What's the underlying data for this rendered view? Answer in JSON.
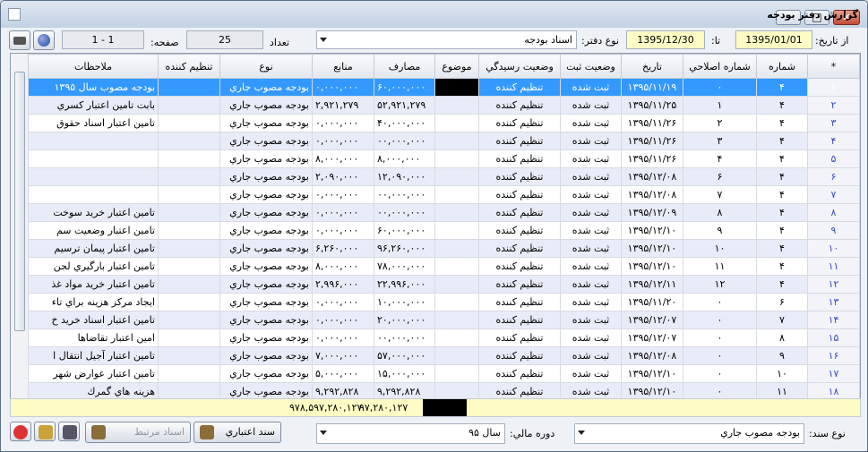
{
  "window": {
    "title": "گزارش دفتر بودجه"
  },
  "filters": {
    "from_date_label": "از تاریخ:",
    "from_date": "1395/01/01",
    "to_date_label": "تا:",
    "to_date": "1395/12/30",
    "book_type_label": "نوع دفتر:",
    "book_type": "اسناد بودجه",
    "count_label": "تعداد",
    "count": "25",
    "page_label": "صفحه:",
    "page": "1 - 1"
  },
  "columns": [
    "*",
    "شماره",
    "شماره اصلاحي",
    "تاريخ",
    "وضعيت ثبت",
    "وضعيت رسيدگي",
    "موضوع",
    "مصارف",
    "منابع",
    "نوع",
    "تنظيم كننده",
    "ملاحظات"
  ],
  "rows": [
    {
      "idx": "۱",
      "num": "۴",
      "fix": "۰",
      "date": "۱۳۹۵/۱۱/۱۹",
      "reg": "ثبت شده",
      "rev": "تنظيم كننده",
      "subj": "",
      "exp": "۶۰,۰۰۰,۰۰۰",
      "src": "۰,۰۰۰,۰۰۰",
      "type": "بودجه مصوب جاري",
      "prep": "",
      "note": "بودجه مصوب سال ۱۳۹۵"
    },
    {
      "idx": "۲",
      "num": "۴",
      "fix": "۱",
      "date": "۱۳۹۵/۱۱/۲۵",
      "reg": "ثبت شده",
      "rev": "تنظيم كننده",
      "subj": "",
      "exp": "۵۲,۹۲۱,۲۷۹",
      "src": "۲,۹۲۱,۲۷۹",
      "type": "بودجه مصوب جاري",
      "prep": "",
      "note": "بابت تامين اعتبار كسري"
    },
    {
      "idx": "۳",
      "num": "۴",
      "fix": "۲",
      "date": "۱۳۹۵/۱۱/۲۶",
      "reg": "ثبت شده",
      "rev": "تنظيم كننده",
      "subj": "",
      "exp": "۴۰,۰۰۰,۰۰۰",
      "src": "۰,۰۰۰,۰۰۰",
      "type": "بودجه مصوب جاري",
      "prep": "",
      "note": "تامين اعتبار اسناد حقوق"
    },
    {
      "idx": "۴",
      "num": "۴",
      "fix": "۳",
      "date": "۱۳۹۵/۱۱/۲۶",
      "reg": "ثبت شده",
      "rev": "تنظيم كننده",
      "subj": "",
      "exp": "۰۰,۰۰۰,۰۰۰",
      "src": "۰,۰۰۰,۰۰۰",
      "type": "بودجه مصوب جاري",
      "prep": "",
      "note": ""
    },
    {
      "idx": "۵",
      "num": "۴",
      "fix": "۴",
      "date": "۱۳۹۵/۱۱/۲۶",
      "reg": "ثبت شده",
      "rev": "تنظيم كننده",
      "subj": "",
      "exp": "۸,۰۰۰,۰۰۰",
      "src": "۸,۰۰۰,۰۰۰",
      "type": "بودجه مصوب جاري",
      "prep": "",
      "note": ""
    },
    {
      "idx": "۶",
      "num": "۴",
      "fix": "۶",
      "date": "۱۳۹۵/۱۲/۰۸",
      "reg": "ثبت شده",
      "rev": "تنظيم كننده",
      "subj": "",
      "exp": "۱۲,۰۹۰,۰۰۰",
      "src": "۲,۰۹۰,۰۰۰",
      "type": "بودجه مصوب جاري",
      "prep": "",
      "note": ""
    },
    {
      "idx": "۷",
      "num": "۴",
      "fix": "۷",
      "date": "۱۳۹۵/۱۲/۰۸",
      "reg": "ثبت شده",
      "rev": "تنظيم كننده",
      "subj": "",
      "exp": "۰۰,۰۰۰,۰۰۰",
      "src": "۰,۰۰۰,۰۰۰",
      "type": "بودجه مصوب جاري",
      "prep": "",
      "note": ""
    },
    {
      "idx": "۸",
      "num": "۴",
      "fix": "۸",
      "date": "۱۳۹۵/۱۲/۰۹",
      "reg": "ثبت شده",
      "rev": "تنظيم كننده",
      "subj": "",
      "exp": "۰۰,۰۰۰,۰۰۰",
      "src": "۰,۰۰۰,۰۰۰",
      "type": "بودجه مصوب جاري",
      "prep": "",
      "note": "تامين اعتبار خريد سوخت"
    },
    {
      "idx": "۹",
      "num": "۴",
      "fix": "۹",
      "date": "۱۳۹۵/۱۲/۱۰",
      "reg": "ثبت شده",
      "rev": "تنظيم كننده",
      "subj": "",
      "exp": "۶۰,۰۰۰,۰۰۰",
      "src": "۰,۰۰۰,۰۰۰",
      "type": "بودجه مصوب جاري",
      "prep": "",
      "note": "تامين اعتبار وضعيت سم"
    },
    {
      "idx": "۱۰",
      "num": "۴",
      "fix": "۱۰",
      "date": "۱۳۹۵/۱۲/۱۰",
      "reg": "ثبت شده",
      "rev": "تنظيم كننده",
      "subj": "",
      "exp": "۹۶,۲۶۰,۰۰۰",
      "src": "۶,۲۶۰,۰۰۰",
      "type": "بودجه مصوب جاري",
      "prep": "",
      "note": "تامين اعتبار پيمان ترسيم"
    },
    {
      "idx": "۱۱",
      "num": "۴",
      "fix": "۱۱",
      "date": "۱۳۹۵/۱۲/۱۰",
      "reg": "ثبت شده",
      "rev": "تنظيم كننده",
      "subj": "",
      "exp": "۷۸,۰۰۰,۰۰۰",
      "src": "۸,۰۰۰,۰۰۰",
      "type": "بودجه مصوب جاري",
      "prep": "",
      "note": "تامين اعتبار بارگيري لجن"
    },
    {
      "idx": "۱۲",
      "num": "۴",
      "fix": "۱۲",
      "date": "۱۳۹۵/۱۲/۱۱",
      "reg": "ثبت شده",
      "rev": "تنظيم كننده",
      "subj": "",
      "exp": "۲۲,۹۹۶,۰۰۰",
      "src": "۲,۹۹۶,۰۰۰",
      "type": "بودجه مصوب جاري",
      "prep": "",
      "note": "تامين اعتبار خريد مواد غذ"
    },
    {
      "idx": "۱۳",
      "num": "۶",
      "fix": "۰",
      "date": "۱۳۹۵/۱۱/۲۰",
      "reg": "ثبت شده",
      "rev": "تنظيم كننده",
      "subj": "",
      "exp": "۱۰,۰۰۰,۰۰۰",
      "src": "۰,۰۰۰,۰۰۰",
      "type": "بودجه مصوب جاري",
      "prep": "",
      "note": "ايجاد مركز هزينه براي تاء"
    },
    {
      "idx": "۱۴",
      "num": "۷",
      "fix": "۰",
      "date": "۱۳۹۵/۱۲/۰۷",
      "reg": "ثبت شده",
      "rev": "تنظيم كننده",
      "subj": "",
      "exp": "۲۰,۰۰۰,۰۰۰",
      "src": "۰,۰۰۰,۰۰۰",
      "type": "بودجه مصوب جاري",
      "prep": "",
      "note": "تامين اعتبار اسناد خريد خ"
    },
    {
      "idx": "۱۵",
      "num": "۸",
      "fix": "۰",
      "date": "۱۳۹۵/۱۲/۰۷",
      "reg": "ثبت شده",
      "rev": "تنظيم كننده",
      "subj": "",
      "exp": "۰۰,۰۰۰,۰۰۰",
      "src": "۰,۰۰۰,۰۰۰",
      "type": "بودجه مصوب جاري",
      "prep": "",
      "note": "امين اعتبار تقاضاها"
    },
    {
      "idx": "۱۶",
      "num": "۹",
      "fix": "۰",
      "date": "۱۳۹۵/۱۲/۰۸",
      "reg": "ثبت شده",
      "rev": "تنظيم كننده",
      "subj": "",
      "exp": "۵۷,۰۰۰,۰۰۰",
      "src": "۷,۰۰۰,۰۰۰",
      "type": "بودجه مصوب جاري",
      "prep": "",
      "note": "تامين اعتبار آجيل انتقال ا"
    },
    {
      "idx": "۱۷",
      "num": "۱۰",
      "fix": "۰",
      "date": "۱۳۹۵/۱۲/۱۰",
      "reg": "ثبت شده",
      "rev": "تنظيم كننده",
      "subj": "",
      "exp": "۱۵,۰۰۰,۰۰۰",
      "src": "۵,۰۰۰,۰۰۰",
      "type": "بودجه مصوب جاري",
      "prep": "",
      "note": "تامين اعتبار عوارض شهر"
    },
    {
      "idx": "۱۸",
      "num": "۱۱",
      "fix": "۰",
      "date": "۱۳۹۵/۱۲/۱۰",
      "reg": "ثبت شده",
      "rev": "تنظيم كننده",
      "subj": "",
      "exp": "۹,۲۹۲,۸۲۸",
      "src": "۹,۲۹۲,۸۲۸",
      "type": "بودجه مصوب جاري",
      "prep": "",
      "note": "هزينه هاي گمرك"
    }
  ],
  "footer": {
    "total_expenses": "۹۷,۲۸۰,۱۲۷",
    "total_sources": "۹۷۸,۵۹۷,۲۸۰,۱۲۷"
  },
  "bottom": {
    "doc_type_label": "نوع سند:",
    "doc_type": "بودجه مصوب جاري",
    "fiscal_label": "دوره مالي:",
    "fiscal": "سال ۹۵",
    "credit_doc_button": "سند اعتباري",
    "related_docs_button": "اسناد مرتبط"
  }
}
